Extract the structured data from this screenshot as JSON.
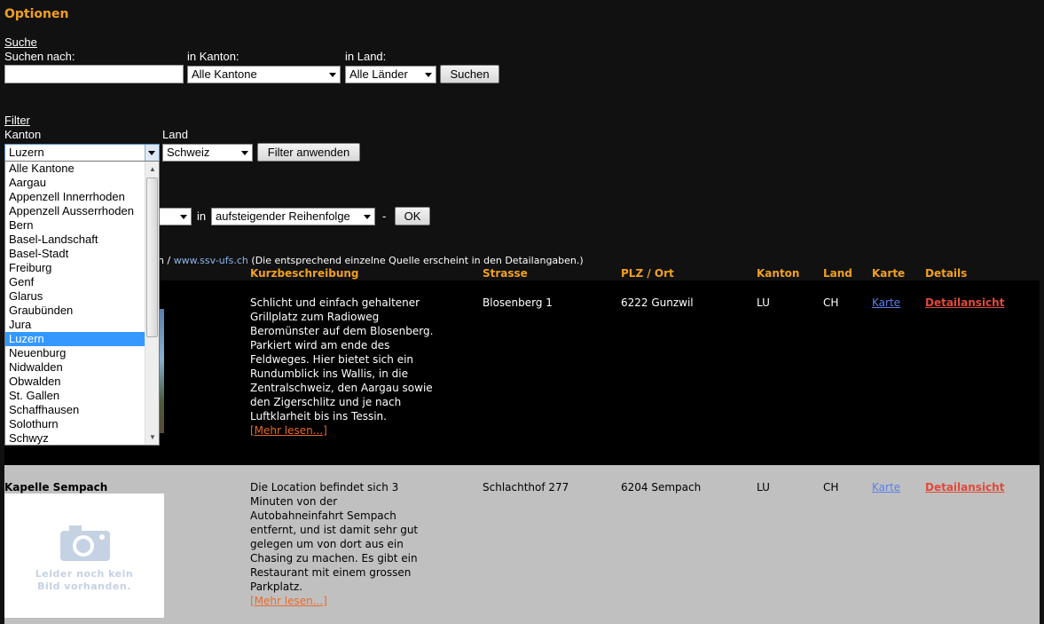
{
  "title": "Optionen",
  "search": {
    "heading": "Suche",
    "query_label": "Suchen nach:",
    "query_value": "",
    "kanton_label": "in Kanton:",
    "kanton_value": "Alle Kantone",
    "land_label": "in Land:",
    "land_value": "Alle Länder",
    "button": "Suchen"
  },
  "filter": {
    "heading": "Filter",
    "kanton_label": "Kanton",
    "kanton_value": "Luzern",
    "land_label": "Land",
    "land_value": "Schweiz",
    "button": "Filter anwenden",
    "kanton_options": [
      "Alle Kantone",
      "Aargau",
      "Appenzell Innerrhoden",
      "Appenzell Ausserrhoden",
      "Bern",
      "Basel-Landschaft",
      "Basel-Stadt",
      "Freiburg",
      "Genf",
      "Glarus",
      "Graubünden",
      "Jura",
      "Luzern",
      "Neuenburg",
      "Nidwalden",
      "Obwalden",
      "St. Gallen",
      "Schaffhausen",
      "Solothurn",
      "Schwyz"
    ],
    "selected_index": 12
  },
  "sort": {
    "in_label": "in",
    "order_value": "aufsteigender Reihenfolge",
    "dash": "-",
    "button": "OK"
  },
  "source": {
    "prefix": "h /",
    "link": "www.ssv-ufs.ch",
    "note": "(Die entsprechend einzelne Quelle erscheint in den Detailangaben.)"
  },
  "columns": [
    "Kurzbeschreibung",
    "Strasse",
    "PLZ / Ort",
    "Kanton",
    "Land",
    "Karte",
    "Details"
  ],
  "rows": [
    {
      "name": "",
      "description": "Schlicht und einfach gehaltener Grillplatz zum Radioweg Beromünster auf dem Blosenberg. Parkiert wird am ende des Feldweges. Hier bietet sich ein Rundumblick ins Wallis, in die Zentralschweiz, den Aargau sowie den Zigerschlitz und je nach Luftklarheit bis ins Tessin.",
      "more": "[Mehr lesen...]",
      "street": "Blosenberg 1",
      "city": "6222 Gunzwil",
      "kanton": "LU",
      "land": "CH",
      "map": "Karte",
      "details": "Detailansicht"
    },
    {
      "name": "Kapelle Sempach",
      "no_image": "Leider noch kein Bild vorhanden.",
      "description": "Die Location befindet sich 3 Minuten von der Autobahneinfahrt Sempach entfernt, und ist damit sehr gut gelegen um von dort aus ein Chasing zu machen. Es gibt ein Restaurant mit einem grossen Parkplatz.",
      "more": "[Mehr lesen...]",
      "street": "Schlachthof 277",
      "city": "6204 Sempach",
      "kanton": "LU",
      "land": "CH",
      "map": "Karte",
      "details": "Detailansicht"
    }
  ]
}
